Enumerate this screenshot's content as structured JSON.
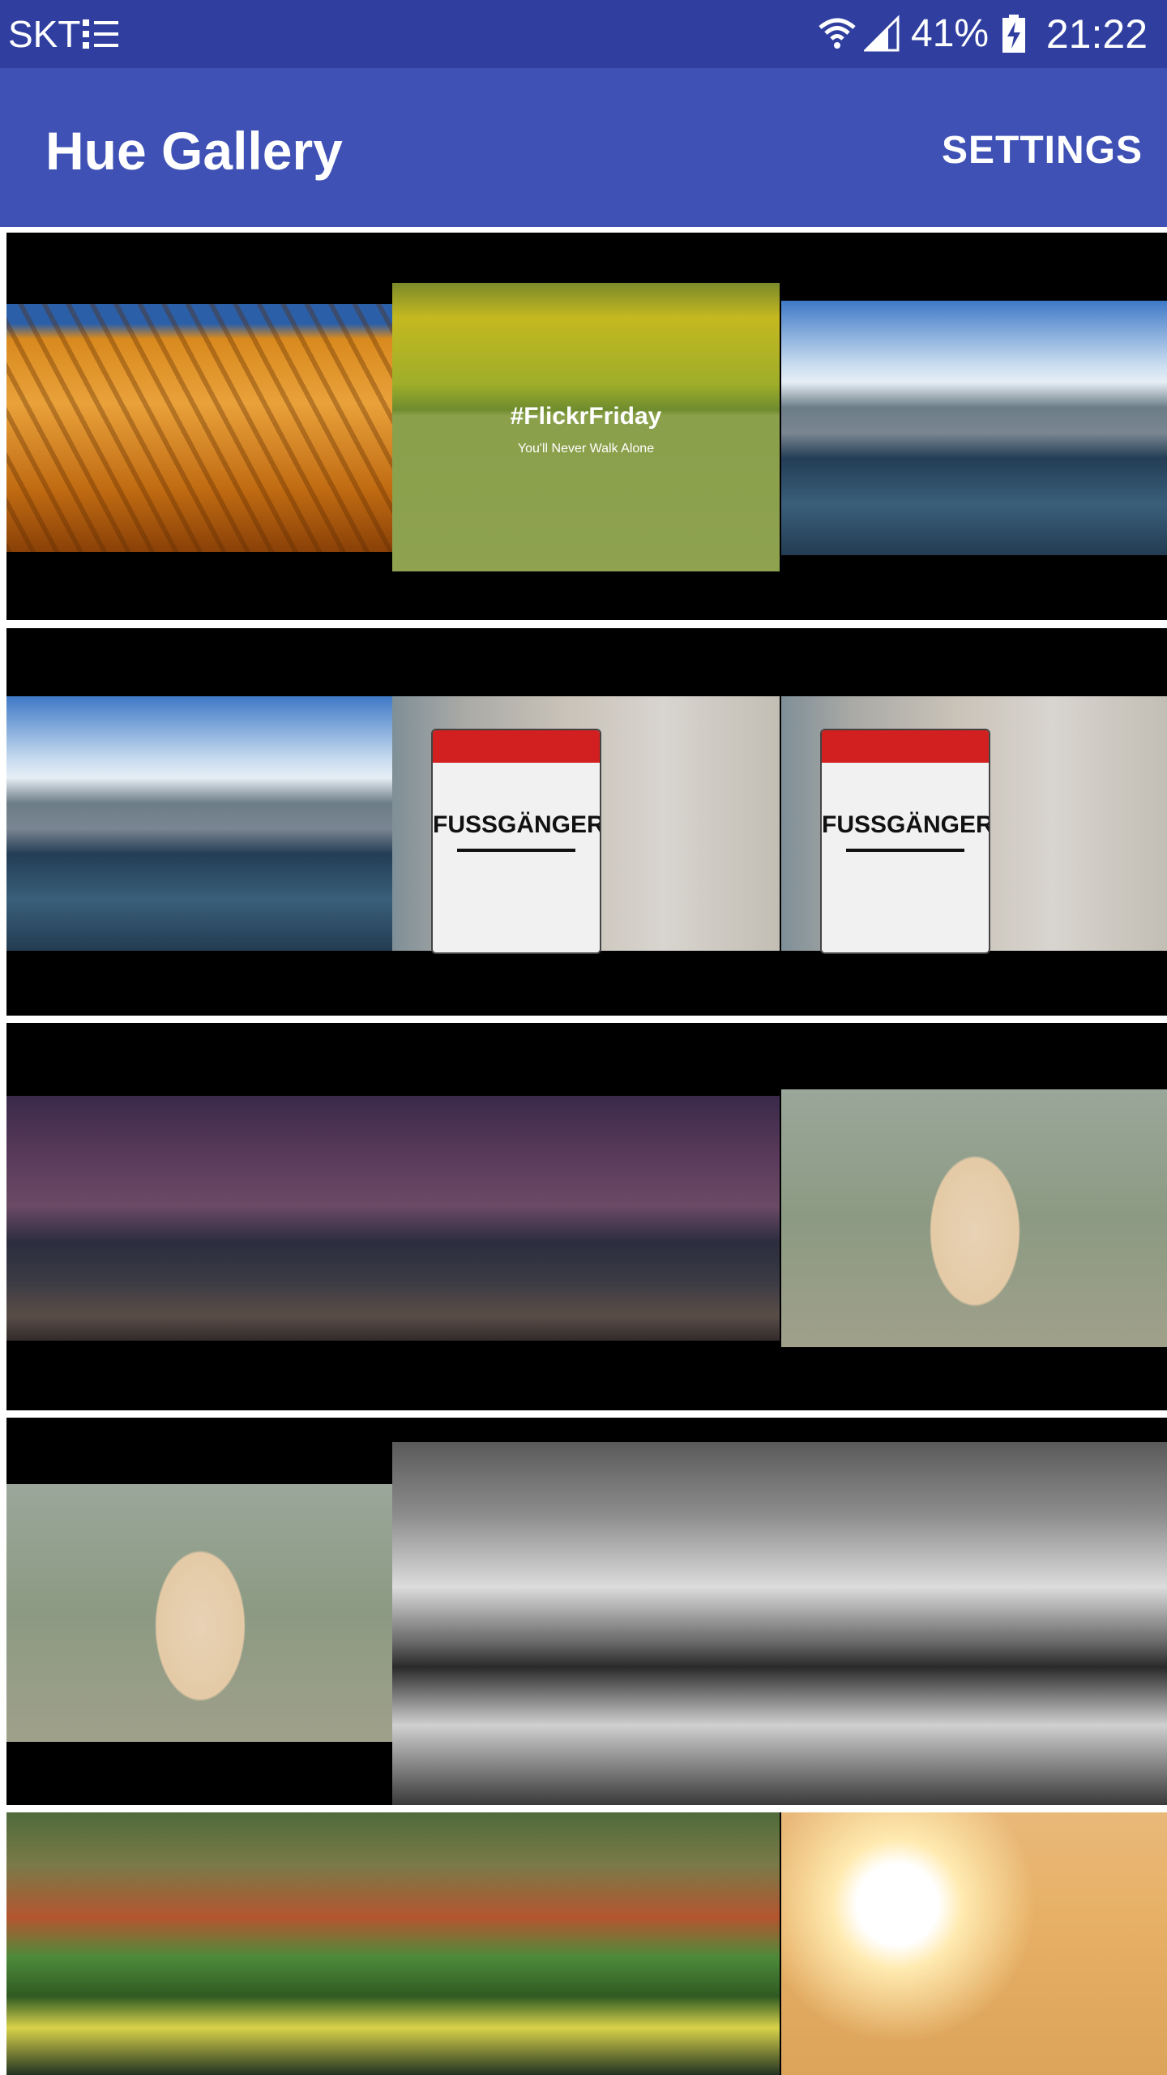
{
  "status_bar": {
    "carrier": "SKT",
    "battery_percent": "41%",
    "time": "21:22",
    "icons": [
      "list-icon",
      "wifi-icon",
      "signal-icon",
      "battery-charging-icon"
    ]
  },
  "app_bar": {
    "title": "Hue Gallery",
    "action": "SETTINGS"
  },
  "colors": {
    "status_bar": "#303f9f",
    "app_bar": "#3f51b5",
    "grid_background": "#000000"
  },
  "gallery": {
    "flickr_title": "#FlickrFriday",
    "flickr_subtitle": "You'll Never Walk Alone",
    "sign_text": "FUSSGÄNGER"
  }
}
